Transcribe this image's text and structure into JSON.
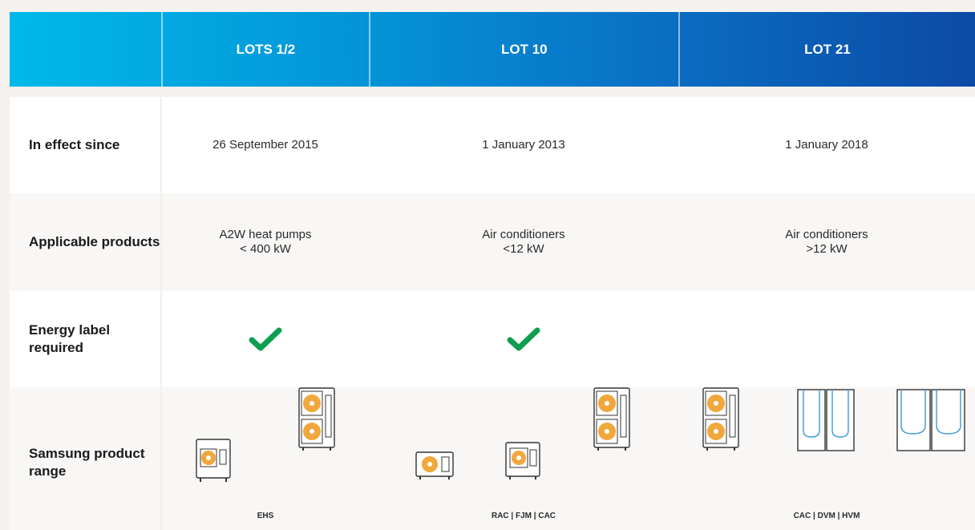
{
  "header": {
    "col1": "LOTS 1/2",
    "col2": "LOT 10",
    "col3": "LOT 21"
  },
  "rows": {
    "in_effect": {
      "label": "In effect since",
      "col1": "26 September 2015",
      "col2": "1 January 2013",
      "col3": "1 January 2018"
    },
    "applicable": {
      "label": "Applicable products",
      "col1_line1": "A2W heat pumps",
      "col1_line2": "< 400 kW",
      "col2_line1": "Air conditioners",
      "col2_line2": "<12 kW",
      "col3_line1": "Air conditioners",
      "col3_line2": ">12 kW"
    },
    "energy_label": {
      "label": "Energy label required",
      "col1": true,
      "col2": true,
      "col3": false
    },
    "product_range": {
      "label": "Samsung product range",
      "col1_caption": "EHS",
      "col2_caption": "RAC | FJM | CAC",
      "col3_caption": "CAC | DVM | HVM"
    }
  },
  "colors": {
    "check": "#0e9e50",
    "fan": "#f0a83c",
    "header_start": "#00b9ea",
    "header_end": "#0c4aa6"
  }
}
